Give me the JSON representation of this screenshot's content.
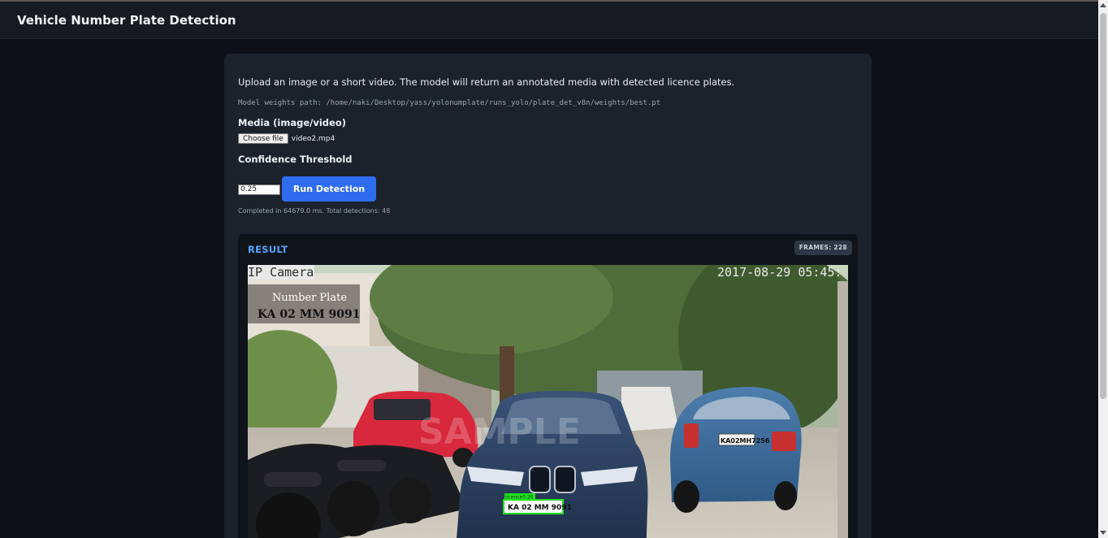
{
  "header": {
    "title": "Vehicle Number Plate Detection"
  },
  "form": {
    "intro": "Upload an image or a short video. The model will return an annotated media with detected licence plates.",
    "weights_path": "Model weights path: /home/naki/Desktop/yass/yolonumplate/runs_yolo/plate_det_v8n/weights/best.pt",
    "media_label": "Media (image/video)",
    "choose_file_label": "Choose file",
    "file_name": "video2.mp4",
    "confidence_label": "Confidence Threshold",
    "confidence_value": "0.25",
    "run_button_label": "Run Detection",
    "status": "Completed in 64679.0 ms. Total detections: 48"
  },
  "result": {
    "title": "RESULT",
    "frames_badge": "FRAMES: 228",
    "overlay": {
      "camera_label": "IP Camera",
      "timestamp": "2017-08-29 05:45:",
      "caption_line1": "Number Plate",
      "caption_line2": "KA 02 MM 9091",
      "detection_label": "licence0.26",
      "main_plate": "KA 02 MM 9091",
      "second_plate": "KA02MH7256",
      "watermark": "SAMPLE"
    }
  },
  "colors": {
    "page_bg": "#0d1117",
    "card_bg": "#1b222c",
    "accent_blue": "#2f6df0",
    "result_title": "#58a6ff",
    "detection_box": "#22e022"
  }
}
